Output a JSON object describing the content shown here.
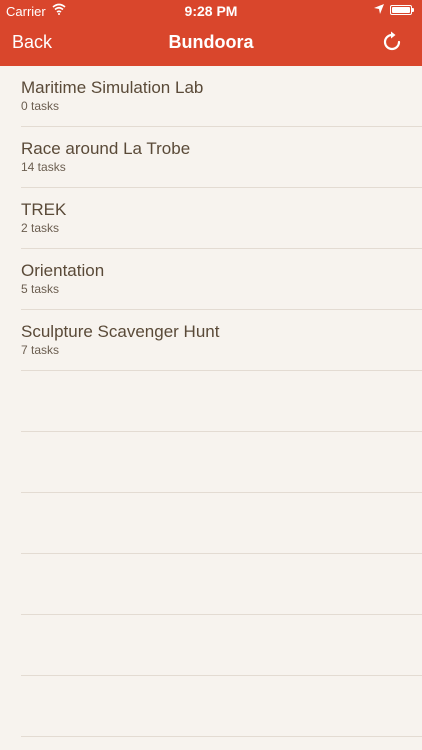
{
  "status_bar": {
    "carrier": "Carrier",
    "time": "9:28 PM",
    "icons": [
      "wifi-icon",
      "location-arrow-icon",
      "battery-icon"
    ]
  },
  "nav": {
    "back_label": "Back",
    "title": "Bundoora",
    "refresh_icon": "refresh-icon"
  },
  "colors": {
    "accent": "#d9462c",
    "background": "#f7f3ee",
    "text": "#5a4a38"
  },
  "items": [
    {
      "name": "Maritime Simulation Lab",
      "count": "0 tasks"
    },
    {
      "name": "Race around La Trobe",
      "count": "14 tasks"
    },
    {
      "name": "TREK",
      "count": "2 tasks"
    },
    {
      "name": "Orientation",
      "count": "5 tasks"
    },
    {
      "name": "Sculpture Scavenger Hunt",
      "count": "7 tasks"
    }
  ]
}
